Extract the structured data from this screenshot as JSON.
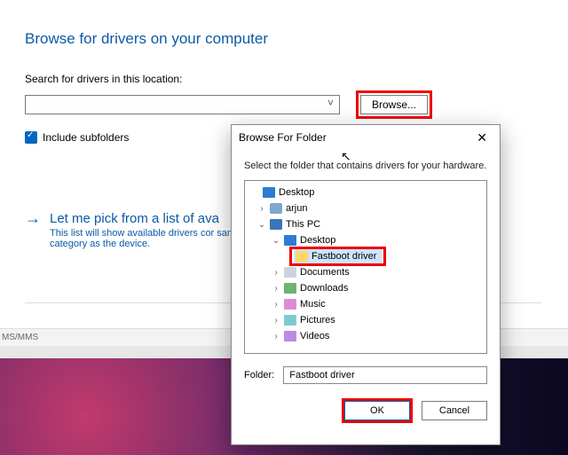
{
  "main": {
    "heading": "Browse for drivers on your computer",
    "search_label": "Search for drivers in this location:",
    "path_value": "",
    "browse_label": "Browse...",
    "include_subfolders_label": "Include subfolders",
    "include_subfolders_checked": true,
    "pick_title": "Let me pick from a list of ava",
    "pick_sub": "This list will show available drivers cor same category as the device."
  },
  "strip": {
    "text": "MS/MMS"
  },
  "dialog": {
    "title": "Browse For Folder",
    "instruction": "Select the folder that contains drivers for your hardware.",
    "tree": {
      "desktop": "Desktop",
      "user": "arjun",
      "this_pc": "This PC",
      "pc_desktop": "Desktop",
      "fastboot": "Fastboot driver",
      "documents": "Documents",
      "downloads": "Downloads",
      "music": "Music",
      "pictures": "Pictures",
      "videos": "Videos"
    },
    "folder_label": "Folder:",
    "folder_value": "Fastboot driver",
    "ok_label": "OK",
    "cancel_label": "Cancel"
  }
}
